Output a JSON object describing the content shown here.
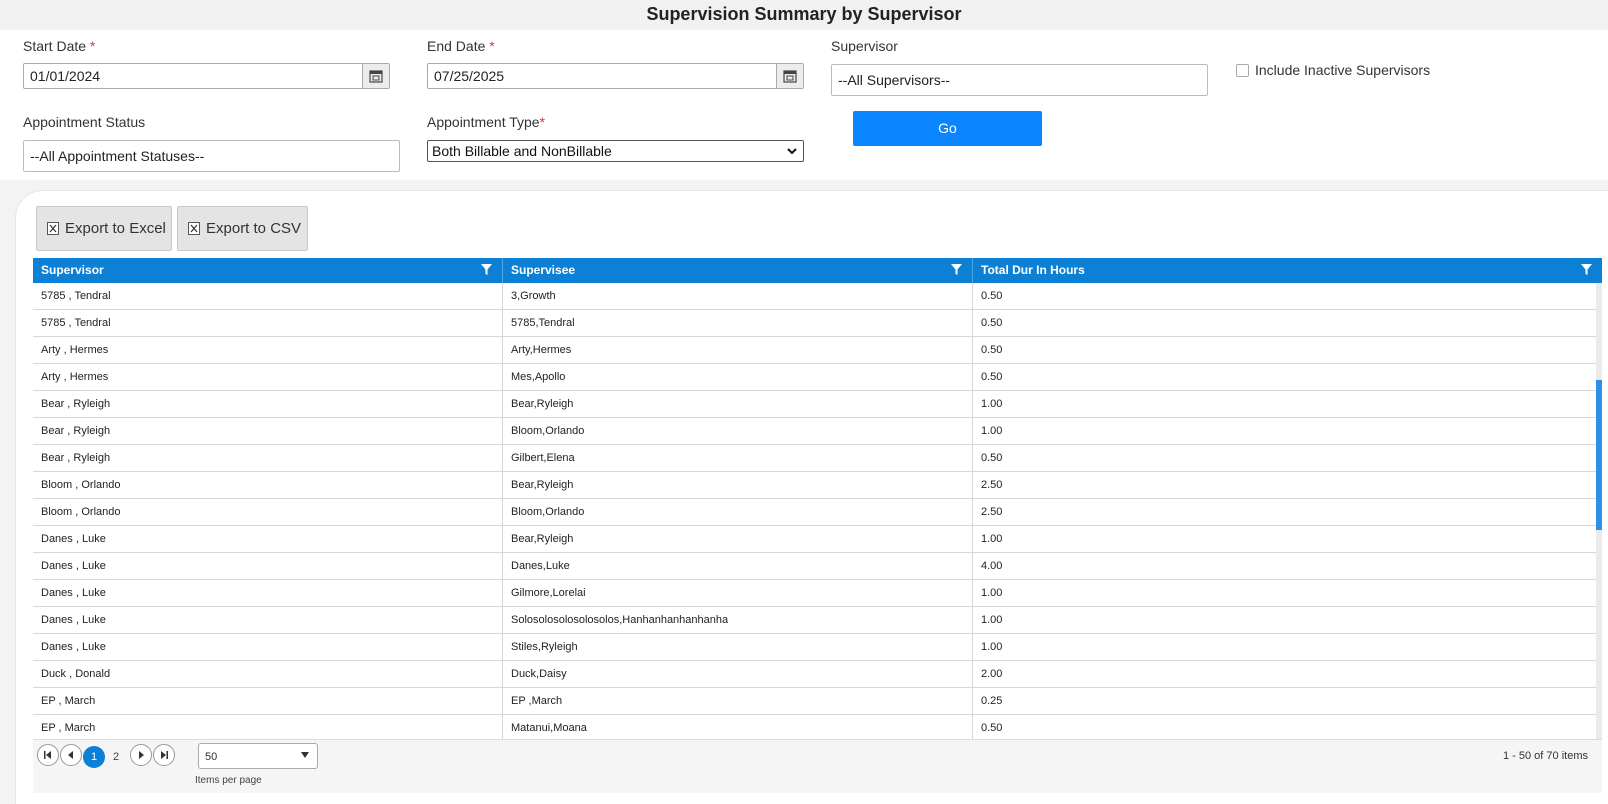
{
  "title": "Supervision Summary by Supervisor",
  "filters": {
    "start_date": {
      "label": "Start Date",
      "required": "*",
      "value": "01/01/2024"
    },
    "end_date": {
      "label": "End Date",
      "required": "*",
      "value": "07/25/2025"
    },
    "supervisor": {
      "label": "Supervisor",
      "value": "--All Supervisors--"
    },
    "include_inactive": {
      "label": "Include Inactive Supervisors",
      "checked": false
    },
    "appointment_status": {
      "label": "Appointment Status",
      "value": "--All Appointment Statuses--"
    },
    "appointment_type": {
      "label": "Appointment Type",
      "required": "*",
      "value": "Both Billable and NonBillable"
    },
    "go_label": "Go"
  },
  "toolbar": {
    "export_excel": "Export to Excel",
    "export_csv": "Export to CSV"
  },
  "grid": {
    "columns": [
      "Supervisor",
      "Supervisee",
      "Total Dur In Hours"
    ],
    "rows": [
      [
        "5785 , Tendral",
        "3,Growth",
        "0.50"
      ],
      [
        "5785 , Tendral",
        "5785,Tendral",
        "0.50"
      ],
      [
        "Arty , Hermes",
        "Arty,Hermes",
        "0.50"
      ],
      [
        "Arty , Hermes",
        "Mes,Apollo",
        "0.50"
      ],
      [
        "Bear , Ryleigh",
        "Bear,Ryleigh",
        "1.00"
      ],
      [
        "Bear , Ryleigh",
        "Bloom,Orlando",
        "1.00"
      ],
      [
        "Bear , Ryleigh",
        "Gilbert,Elena",
        "0.50"
      ],
      [
        "Bloom , Orlando",
        "Bear,Ryleigh",
        "2.50"
      ],
      [
        "Bloom , Orlando",
        "Bloom,Orlando",
        "2.50"
      ],
      [
        "Danes , Luke",
        "Bear,Ryleigh",
        "1.00"
      ],
      [
        "Danes , Luke",
        "Danes,Luke",
        "4.00"
      ],
      [
        "Danes , Luke",
        "Gilmore,Lorelai",
        "1.00"
      ],
      [
        "Danes , Luke",
        "Solosolosolosolosolos,Hanhanhanhanhanha",
        "1.00"
      ],
      [
        "Danes , Luke",
        "Stiles,Ryleigh",
        "1.00"
      ],
      [
        "Duck , Donald",
        "Duck,Daisy",
        "2.00"
      ],
      [
        "EP , March",
        "EP ,March",
        "0.25"
      ],
      [
        "EP , March",
        "Matanui,Moana",
        "0.50"
      ]
    ]
  },
  "pager": {
    "pages": [
      "1",
      "2"
    ],
    "current_page": "1",
    "page_size": "50",
    "items_per_page_label": "Items per page",
    "items_summary": "1 - 50 of 70 items"
  },
  "colors": {
    "accent": "#0a84ff",
    "header": "#0c80d4",
    "required": "#d9363e"
  },
  "icons": [
    "calendar-icon",
    "chevron-down-icon",
    "excel-file-icon",
    "csv-file-icon",
    "filter-icon",
    "first-page-icon",
    "prev-page-icon",
    "next-page-icon",
    "last-page-icon"
  ]
}
